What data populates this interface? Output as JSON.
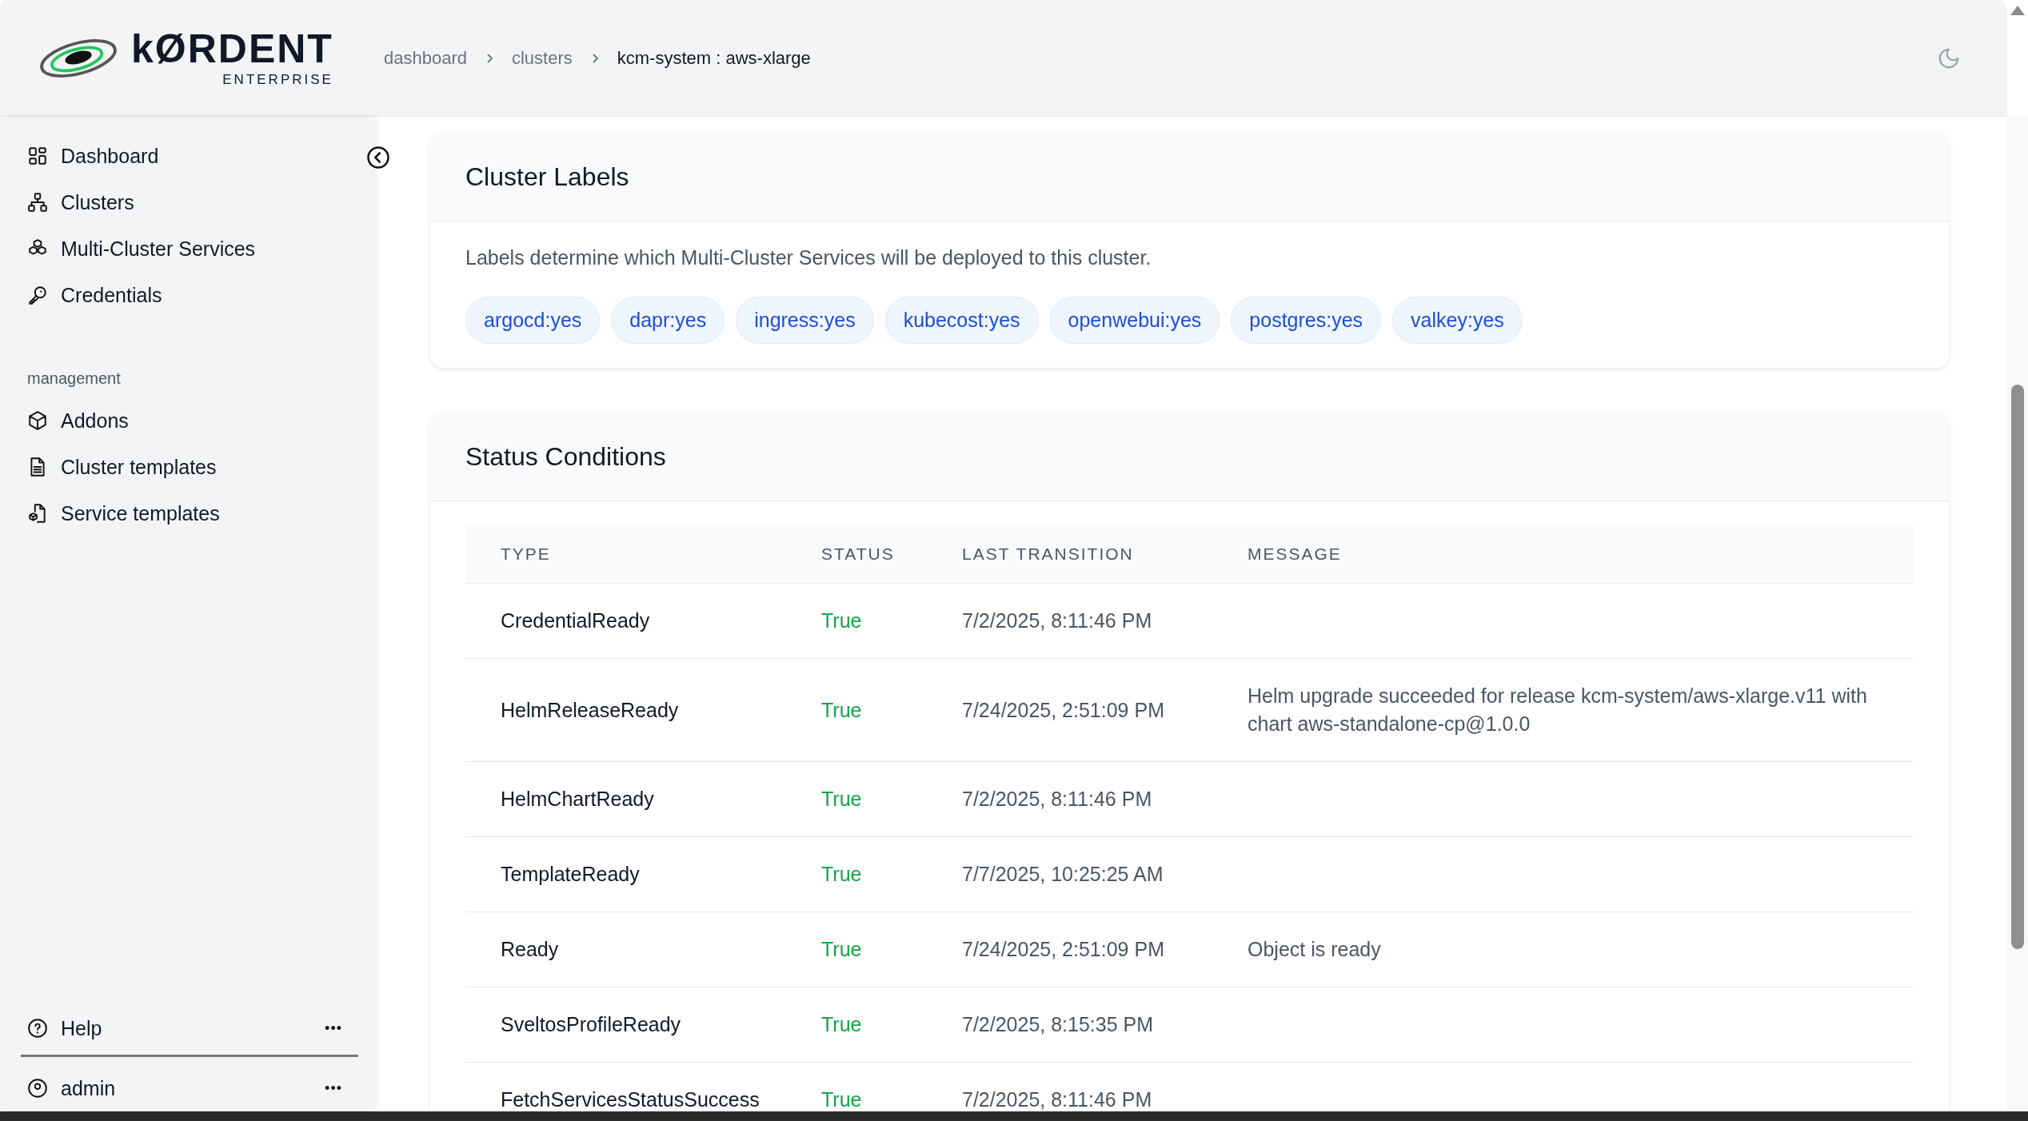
{
  "logo": {
    "wordmark": "kØRDENT",
    "edition": "ENTERPRISE"
  },
  "breadcrumb": [
    {
      "label": "dashboard",
      "current": false
    },
    {
      "label": "clusters",
      "current": false
    },
    {
      "label": "kcm-system : aws-xlarge",
      "current": true
    }
  ],
  "sidebar": {
    "groups": [
      {
        "items": [
          {
            "label": "Dashboard"
          },
          {
            "label": "Clusters"
          },
          {
            "label": "Multi-Cluster Services"
          },
          {
            "label": "Credentials"
          }
        ]
      },
      {
        "heading": "management",
        "items": [
          {
            "label": "Addons"
          },
          {
            "label": "Cluster templates"
          },
          {
            "label": "Service templates"
          }
        ]
      }
    ],
    "footer": [
      {
        "label": "Help",
        "more": "•••"
      },
      {
        "label": "admin",
        "more": "•••"
      }
    ]
  },
  "cluster_labels": {
    "title": "Cluster Labels",
    "description": "Labels determine which Multi-Cluster Services will be deployed to this cluster.",
    "labels": [
      "argocd:yes",
      "dapr:yes",
      "ingress:yes",
      "kubecost:yes",
      "openwebui:yes",
      "postgres:yes",
      "valkey:yes"
    ]
  },
  "status_conditions": {
    "title": "Status Conditions",
    "columns": [
      "TYPE",
      "STATUS",
      "LAST TRANSITION",
      "MESSAGE"
    ],
    "rows": [
      {
        "type": "CredentialReady",
        "status": "True",
        "healthy": true,
        "last_transition": "7/2/2025, 8:11:46 PM"
      },
      {
        "type": "HelmReleaseReady",
        "status": "True",
        "healthy": true,
        "last_transition": "7/24/2025, 2:51:09 PM",
        "message": "Helm upgrade succeeded for release kcm-system/aws-xlarge.v11 with chart aws-standalone-cp@1.0.0"
      },
      {
        "type": "HelmChartReady",
        "status": "True",
        "healthy": true,
        "last_transition": "7/2/2025, 8:11:46 PM"
      },
      {
        "type": "TemplateReady",
        "status": "True",
        "healthy": true,
        "last_transition": "7/7/2025, 10:25:25 AM"
      },
      {
        "type": "Ready",
        "status": "True",
        "healthy": true,
        "last_transition": "7/24/2025, 2:51:09 PM",
        "message": "Object is ready"
      },
      {
        "type": "SveltosProfileReady",
        "status": "True",
        "healthy": true,
        "last_transition": "7/2/2025, 8:15:35 PM"
      },
      {
        "type": "FetchServicesStatusSuccess",
        "status": "True",
        "healthy": true,
        "last_transition": "7/2/2025, 8:11:46 PM"
      }
    ]
  }
}
